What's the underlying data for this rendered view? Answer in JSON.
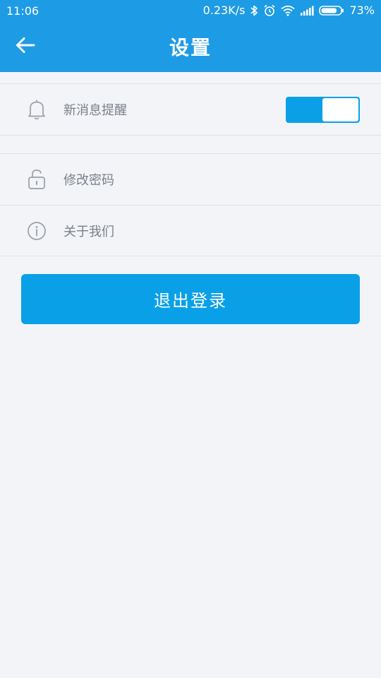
{
  "status_bar": {
    "time": "11:06",
    "net_speed": "0.23K/s",
    "battery": "73%",
    "icons": [
      "bluetooth-icon",
      "alarm-icon",
      "wifi-icon",
      "signal-icon",
      "battery-icon"
    ]
  },
  "nav": {
    "title": "设置",
    "back_icon": "arrow-left-icon"
  },
  "settings": {
    "notification": {
      "label": "新消息提醒",
      "icon": "bell-icon",
      "enabled": true
    },
    "change_password": {
      "label": "修改密码",
      "icon": "unlock-icon"
    },
    "about": {
      "label": "关于我们",
      "icon": "info-icon"
    }
  },
  "logout": {
    "label": "退出登录"
  },
  "colors": {
    "primary": "#1e9be5",
    "button": "#0aa0e8",
    "background": "#f2f4f8",
    "text": "#7b8087",
    "divider": "#dfe2e6"
  }
}
